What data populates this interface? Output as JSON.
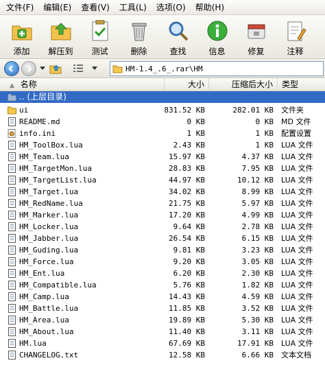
{
  "menu": [
    "文件(F)",
    "编辑(E)",
    "查看(V)",
    "工具(L)",
    "选项(O)",
    "帮助(H)"
  ],
  "toolbar": [
    {
      "label": "添加",
      "icon": "add-icon"
    },
    {
      "label": "解压到",
      "icon": "extract-icon"
    },
    {
      "label": "测试",
      "icon": "test-icon"
    },
    {
      "label": "删除",
      "icon": "delete-icon"
    },
    {
      "label": "查找",
      "icon": "find-icon"
    },
    {
      "label": "信息",
      "icon": "info-icon"
    },
    {
      "label": "修复",
      "icon": "repair-icon"
    },
    {
      "label": "注释",
      "icon": "comment-icon"
    }
  ],
  "address": {
    "path": "HM-1.4_.6_.rar\\HM"
  },
  "columns": {
    "name": "名称",
    "size": "大小",
    "packed": "压缩后大小",
    "type": "类型"
  },
  "parent_row": {
    "name": ".. (上层目录)"
  },
  "files": [
    {
      "name": "ui",
      "size": "831.52 KB",
      "packed": "282.01 KB",
      "type": "文件夹",
      "kind": "folder"
    },
    {
      "name": "README.md",
      "size": "0 KB",
      "packed": "0 KB",
      "type": "MD 文件",
      "kind": "file"
    },
    {
      "name": "info.ini",
      "size": "1 KB",
      "packed": "1 KB",
      "type": "配置设置",
      "kind": "ini"
    },
    {
      "name": "HM_ToolBox.lua",
      "size": "2.43 KB",
      "packed": "1 KB",
      "type": "LUA 文件",
      "kind": "file"
    },
    {
      "name": "HM_Team.lua",
      "size": "15.97 KB",
      "packed": "4.37 KB",
      "type": "LUA 文件",
      "kind": "file"
    },
    {
      "name": "HM_TargetMon.lua",
      "size": "28.83 KB",
      "packed": "7.95 KB",
      "type": "LUA 文件",
      "kind": "file"
    },
    {
      "name": "HM_TargetList.lua",
      "size": "44.97 KB",
      "packed": "10.12 KB",
      "type": "LUA 文件",
      "kind": "file"
    },
    {
      "name": "HM_Target.lua",
      "size": "34.02 KB",
      "packed": "8.99 KB",
      "type": "LUA 文件",
      "kind": "file"
    },
    {
      "name": "HM_RedName.lua",
      "size": "21.75 KB",
      "packed": "5.97 KB",
      "type": "LUA 文件",
      "kind": "file"
    },
    {
      "name": "HM_Marker.lua",
      "size": "17.20 KB",
      "packed": "4.99 KB",
      "type": "LUA 文件",
      "kind": "file"
    },
    {
      "name": "HM_Locker.lua",
      "size": "9.64 KB",
      "packed": "2.78 KB",
      "type": "LUA 文件",
      "kind": "file"
    },
    {
      "name": "HM_Jabber.lua",
      "size": "26.54 KB",
      "packed": "6.15 KB",
      "type": "LUA 文件",
      "kind": "file"
    },
    {
      "name": "HM_Guding.lua",
      "size": "9.81 KB",
      "packed": "3.23 KB",
      "type": "LUA 文件",
      "kind": "file"
    },
    {
      "name": "HM_Force.lua",
      "size": "9.20 KB",
      "packed": "3.05 KB",
      "type": "LUA 文件",
      "kind": "file"
    },
    {
      "name": "HM_Ent.lua",
      "size": "6.20 KB",
      "packed": "2.30 KB",
      "type": "LUA 文件",
      "kind": "file"
    },
    {
      "name": "HM_Compatible.lua",
      "size": "5.76 KB",
      "packed": "1.82 KB",
      "type": "LUA 文件",
      "kind": "file"
    },
    {
      "name": "HM_Camp.lua",
      "size": "14.43 KB",
      "packed": "4.59 KB",
      "type": "LUA 文件",
      "kind": "file"
    },
    {
      "name": "HM_Battle.lua",
      "size": "11.85 KB",
      "packed": "3.52 KB",
      "type": "LUA 文件",
      "kind": "file"
    },
    {
      "name": "HM_Area.lua",
      "size": "19.89 KB",
      "packed": "5.30 KB",
      "type": "LUA 文件",
      "kind": "file"
    },
    {
      "name": "HM_About.lua",
      "size": "11.40 KB",
      "packed": "3.11 KB",
      "type": "LUA 文件",
      "kind": "file"
    },
    {
      "name": "HM.lua",
      "size": "67.69 KB",
      "packed": "17.91 KB",
      "type": "LUA 文件",
      "kind": "file"
    },
    {
      "name": "CHANGELOG.txt",
      "size": "12.58 KB",
      "packed": "6.66 KB",
      "type": "文本文档",
      "kind": "file"
    }
  ],
  "colors": {
    "selection": "#316ac5",
    "folder": "#f2c94c"
  }
}
